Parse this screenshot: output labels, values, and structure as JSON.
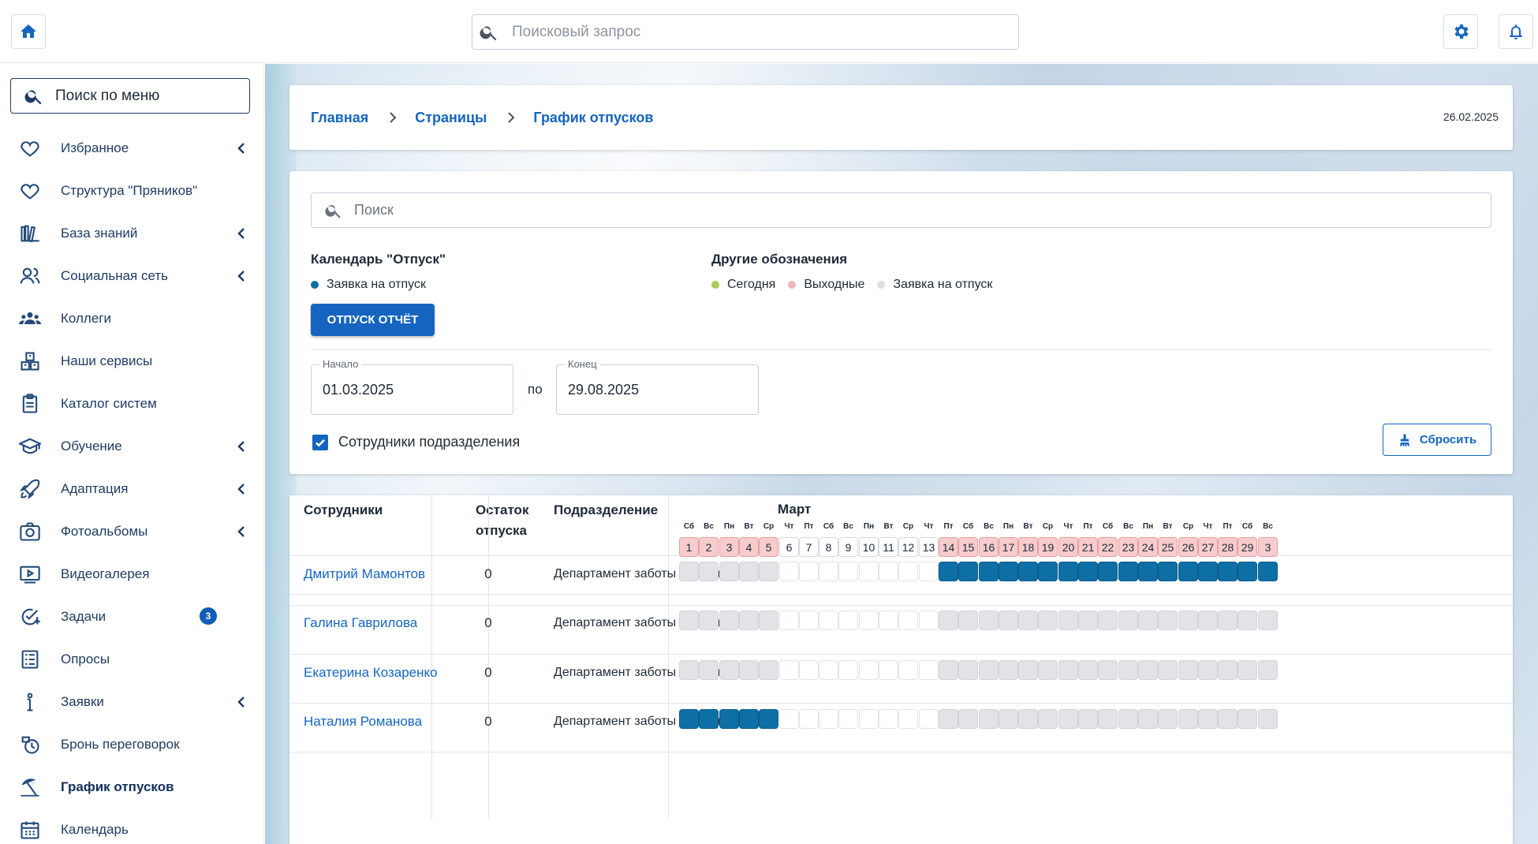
{
  "search": {
    "placeholder": "Поисковый запрос"
  },
  "sidebar": {
    "search_label": "Поиск по меню",
    "items": [
      {
        "label": "Избранное",
        "icon": "heart-icon",
        "chevron": true
      },
      {
        "label": "Структура \"Пряников\"",
        "icon": "heart-icon",
        "chevron": false
      },
      {
        "label": "База знаний",
        "icon": "books-icon",
        "chevron": true
      },
      {
        "label": "Социальная сеть",
        "icon": "people-icon",
        "chevron": true
      },
      {
        "label": "Коллеги",
        "icon": "group-icon",
        "chevron": false
      },
      {
        "label": "Наши сервисы",
        "icon": "boxes-icon",
        "chevron": false
      },
      {
        "label": "Каталог систем",
        "icon": "clipboard-icon",
        "chevron": false
      },
      {
        "label": "Обучение",
        "icon": "graduation-cap-icon",
        "chevron": true
      },
      {
        "label": "Адаптация",
        "icon": "rocket-icon",
        "chevron": true
      },
      {
        "label": "Фотоальбомы",
        "icon": "camera-icon",
        "chevron": true
      },
      {
        "label": "Видеогалерея",
        "icon": "video-icon",
        "chevron": false
      },
      {
        "label": "Задачи",
        "icon": "task-check-icon",
        "chevron": false,
        "badge": "3"
      },
      {
        "label": "Опросы",
        "icon": "survey-icon",
        "chevron": false
      },
      {
        "label": "Заявки",
        "icon": "info-icon",
        "chevron": true
      },
      {
        "label": "Бронь переговорок",
        "icon": "clock-icon",
        "chevron": false
      },
      {
        "label": "График отпусков",
        "icon": "beach-umbrella-icon",
        "chevron": false,
        "active": true
      },
      {
        "label": "Календарь",
        "icon": "calendar-icon",
        "chevron": false
      }
    ]
  },
  "breadcrumbs": [
    "Главная",
    "Страницы",
    "График отпусков"
  ],
  "date": "26.02.2025",
  "filter": {
    "search_placeholder": "Поиск",
    "calendar_title": "Календарь \"Отпуск\"",
    "calendar_legend": "Заявка на отпуск",
    "other_title": "Другие обозначения",
    "other_legend": [
      "Сегодня",
      "Выходные",
      "Заявка на отпуск"
    ],
    "report_button": "ОТПУСК ОТЧЁТ",
    "start_label": "Начало",
    "start_value": "01.03.2025",
    "po": "по",
    "end_label": "Конец",
    "end_value": "29.08.2025",
    "checkbox_label": "Сотрудники подразделения",
    "checkbox_checked": true,
    "reset_button": "Сбросить"
  },
  "colors": {
    "accent": "#1565c0",
    "vacation": "#0e6fa5",
    "today": "#a6cf5a",
    "weekend": "#f2b7b9",
    "request": "#dcdde0"
  },
  "table": {
    "headers": {
      "employees": "Сотрудники",
      "rest": "Остаток\nотпуска",
      "department": "Подразделение"
    },
    "month": "Март",
    "days": [
      {
        "dow": "Сб",
        "n": "1",
        "weekend": true
      },
      {
        "dow": "Вс",
        "n": "2",
        "weekend": true
      },
      {
        "dow": "Пн",
        "n": "3",
        "weekend": true
      },
      {
        "dow": "Вт",
        "n": "4",
        "weekend": true
      },
      {
        "dow": "Ср",
        "n": "5",
        "weekend": true
      },
      {
        "dow": "Чт",
        "n": "6",
        "weekend": false
      },
      {
        "dow": "Пт",
        "n": "7",
        "weekend": false
      },
      {
        "dow": "Сб",
        "n": "8",
        "weekend": false
      },
      {
        "dow": "Вс",
        "n": "9",
        "weekend": false
      },
      {
        "dow": "Пн",
        "n": "10",
        "weekend": false
      },
      {
        "dow": "Вт",
        "n": "11",
        "weekend": false
      },
      {
        "dow": "Ср",
        "n": "12",
        "weekend": false
      },
      {
        "dow": "Чт",
        "n": "13",
        "weekend": false
      },
      {
        "dow": "Пт",
        "n": "14",
        "weekend": true
      },
      {
        "dow": "Сб",
        "n": "15",
        "weekend": true
      },
      {
        "dow": "Вс",
        "n": "16",
        "weekend": true
      },
      {
        "dow": "Пн",
        "n": "17",
        "weekend": true
      },
      {
        "dow": "Вт",
        "n": "18",
        "weekend": true
      },
      {
        "dow": "Ср",
        "n": "19",
        "weekend": true
      },
      {
        "dow": "Чт",
        "n": "20",
        "weekend": true
      },
      {
        "dow": "Пт",
        "n": "21",
        "weekend": true
      },
      {
        "dow": "Сб",
        "n": "22",
        "weekend": true
      },
      {
        "dow": "Вс",
        "n": "23",
        "weekend": true
      },
      {
        "dow": "Пн",
        "n": "24",
        "weekend": true
      },
      {
        "dow": "Вт",
        "n": "25",
        "weekend": true
      },
      {
        "dow": "Ср",
        "n": "26",
        "weekend": true
      },
      {
        "dow": "Чт",
        "n": "27",
        "weekend": true
      },
      {
        "dow": "Пт",
        "n": "28",
        "weekend": true
      },
      {
        "dow": "Сб",
        "n": "29",
        "weekend": true
      },
      {
        "dow": "Вс",
        "n": "3",
        "weekend": true
      }
    ],
    "rows": [
      {
        "name": "Дмитрий Мамонтов",
        "rest": "0",
        "department": "Департамент заботы о клиентах",
        "cells": "gggggwwwwwwwwbbbbbbbbbbbbbbbbb"
      },
      {
        "name": "Галина Гаврилова",
        "rest": "0",
        "department": "Департамент заботы о клиентах",
        "cells": "gggggwwwwwwwwggggggggggggggggg"
      },
      {
        "name": "Екатерина Козаренко",
        "rest": "0",
        "department": "Департамент заботы о клиентах",
        "cells": "gggggwwwwwwwwggggggggggggggggg"
      },
      {
        "name": "Наталия Романова",
        "rest": "0",
        "department": "Департамент заботы о клиентах",
        "cells": "bbbbbwwwwwwwwggggggggggggggggg"
      }
    ]
  }
}
